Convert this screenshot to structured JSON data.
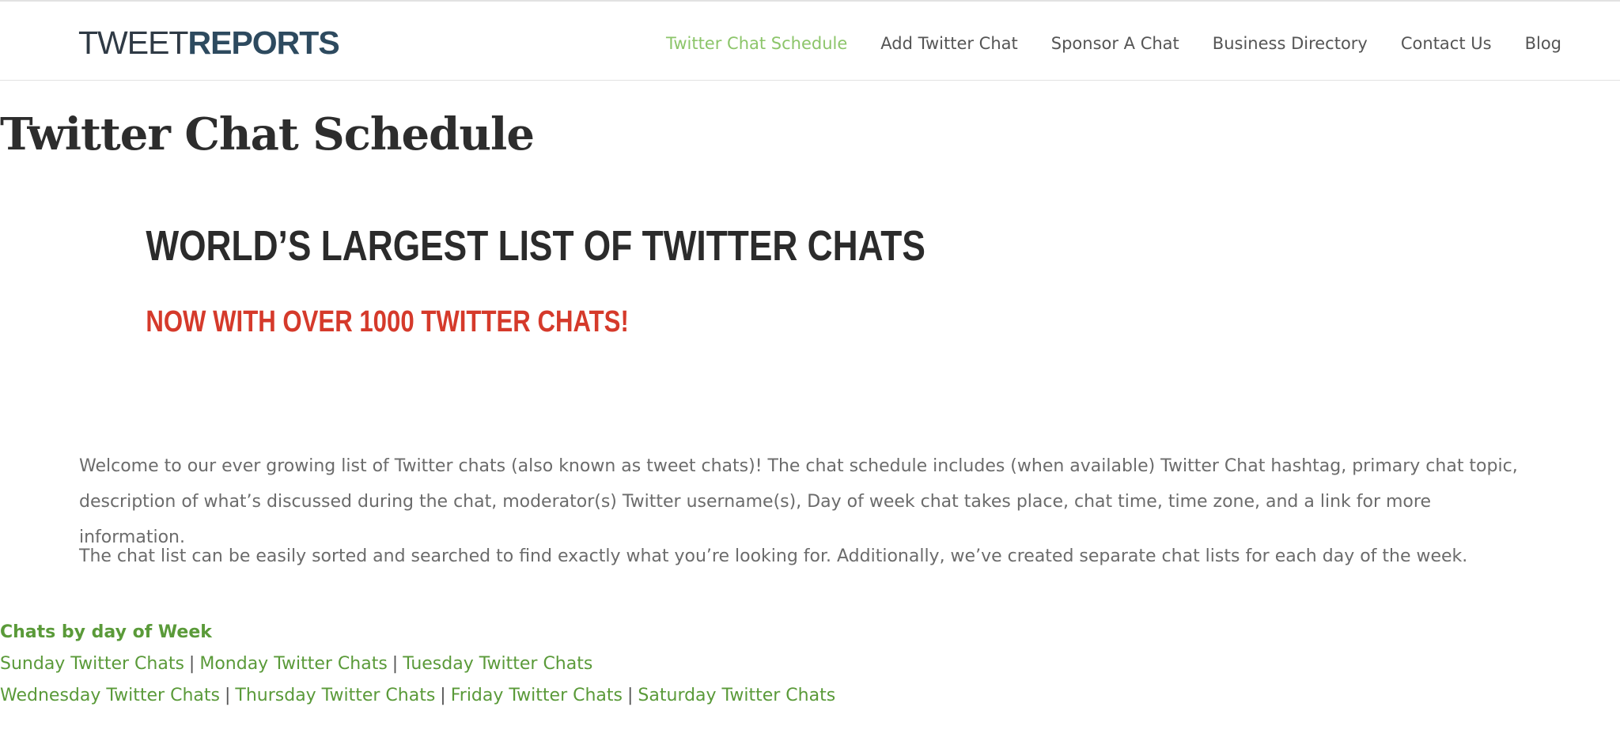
{
  "header": {
    "logo": {
      "light": "TWEET",
      "bold": "REPORTS"
    },
    "nav": [
      {
        "label": "Twitter Chat Schedule",
        "active": true
      },
      {
        "label": "Add Twitter Chat",
        "active": false
      },
      {
        "label": "Sponsor A Chat",
        "active": false
      },
      {
        "label": "Business Directory",
        "active": false
      },
      {
        "label": "Contact Us",
        "active": false
      },
      {
        "label": "Blog",
        "active": false
      }
    ]
  },
  "main": {
    "title": "Twitter Chat Schedule",
    "headline": "WORLD’S LARGEST LIST OF TWITTER CHATS",
    "subheadline": "NOW WITH OVER 1000 TWITTER CHATS!",
    "intro": "Welcome to our ever growing list of Twitter chats (also known as tweet chats)! The chat schedule includes (when available) Twitter Chat hashtag, primary chat topic, description of what’s discussed during the chat, moderator(s) Twitter username(s), Day of week chat takes place, chat time, time zone, and a link for more information.",
    "second": "The chat list can be easily sorted and searched to find exactly what you’re looking for. Additionally, we’ve created separate chat lists for each day of the week.",
    "days": {
      "heading": "Chats by day of Week",
      "separator": "|",
      "row1": [
        "Sunday Twitter Chats",
        "Monday Twitter Chats",
        "Tuesday Twitter Chats"
      ],
      "row2": [
        "Wednesday Twitter Chats",
        "Thursday Twitter Chats",
        "Friday Twitter Chats",
        "Saturday Twitter Chats"
      ]
    }
  },
  "colors": {
    "accent_green": "#8cc56a",
    "link_green": "#5a9a39",
    "headline_red": "#d53a2b",
    "text_dark": "#2d2d2d",
    "text_body": "#6b6b6b"
  }
}
